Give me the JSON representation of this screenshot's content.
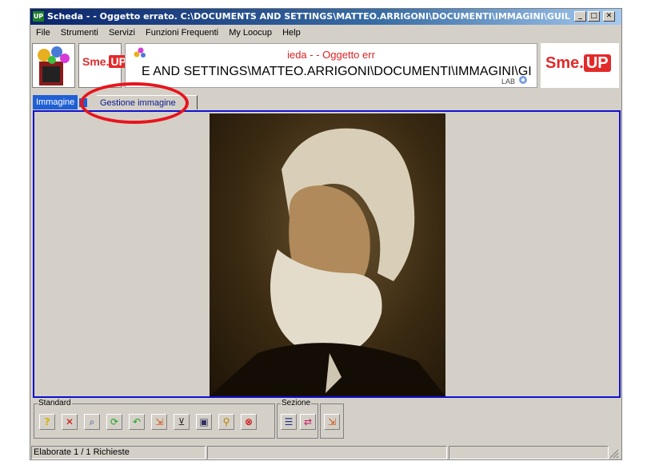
{
  "window": {
    "title": "Scheda - - Oggetto errato. C:\\DOCUMENTS AND SETTINGS\\MATTEO.ARRIGONI\\DOCUMENTI\\IMMAGINI\\GUIL...",
    "app_icon_label": "UP",
    "minimize": "_",
    "maximize": "□",
    "close": "✕"
  },
  "menu": {
    "items": [
      "File",
      "Strumenti",
      "Servizi",
      "Funzioni Frequenti",
      "My Loocup",
      "Help"
    ]
  },
  "banner": {
    "line1": "ieda - - Oggetto err",
    "line2": "E AND SETTINGS\\MATTEO.ARRIGONI\\DOCUMENTI\\IMMAGINI\\GI",
    "brand_left": "Sme.",
    "brand_left_up": "UP",
    "brand_right": "Sme.",
    "brand_right_up": "UP",
    "small_label": "LAB"
  },
  "tabs": [
    {
      "label": "Immagine",
      "active": true
    },
    {
      "label": "Gestione immagine",
      "active": false
    }
  ],
  "toolbar": {
    "standard_label": "Standard",
    "sezione_label": "Sezione",
    "standard_icons": [
      "help-icon",
      "delete-icon",
      "search-icon",
      "refresh-icon",
      "back-icon",
      "export-icon",
      "cart-icon",
      "image-icon",
      "zoom-icon",
      "stop-icon"
    ],
    "sezione_icons": [
      "list-icon",
      "swap-icon",
      "export-icon"
    ]
  },
  "status": {
    "left": "Elaborate 1 / 1 Richieste",
    "mid": "",
    "right": ""
  },
  "colors": {
    "title_start": "#0a246a",
    "content_border": "#1010d0",
    "annotation": "#e8141c",
    "brand_red": "#e32a2a"
  }
}
